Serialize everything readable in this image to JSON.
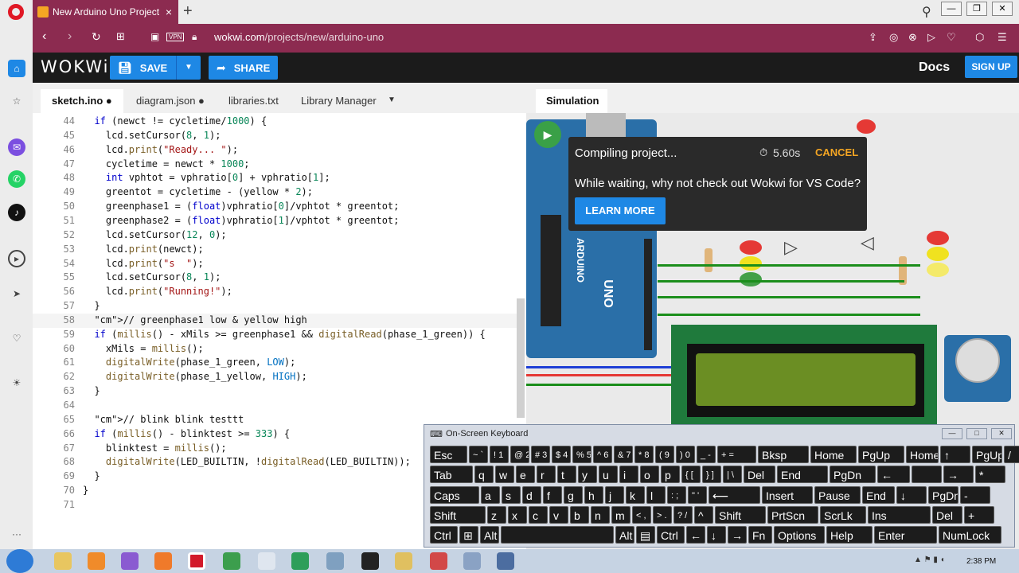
{
  "browser": {
    "tab_title": "New Arduino Uno Project",
    "tab_close": "×",
    "new_tab": "+",
    "url_domain": "wokwi.com",
    "url_path": "/projects/new/arduino-uno",
    "vpn_badge": "VPN"
  },
  "header": {
    "logo": "WOKWi",
    "save_label": "SAVE",
    "share_label": "SHARE",
    "docs_label": "Docs",
    "signup_label": "SIGN UP"
  },
  "editor_tabs": [
    {
      "label": "sketch.ino ●"
    },
    {
      "label": "diagram.json ●"
    },
    {
      "label": "libraries.txt"
    },
    {
      "label": "Library Manager"
    }
  ],
  "code_lines": [
    {
      "n": "44",
      "code": "  if (newct != cycletime/1000) {"
    },
    {
      "n": "45",
      "code": "    lcd.setCursor(8, 1);"
    },
    {
      "n": "46",
      "code": "    lcd.print(\"Ready... \");"
    },
    {
      "n": "47",
      "code": "    cycletime = newct * 1000;"
    },
    {
      "n": "48",
      "code": "    int vphtot = vphratio[0] + vphratio[1];"
    },
    {
      "n": "49",
      "code": "    greentot = cycletime - (yellow * 2);"
    },
    {
      "n": "50",
      "code": "    greenphase1 = (float)vphratio[0]/vphtot * greentot;"
    },
    {
      "n": "51",
      "code": "    greenphase2 = (float)vphratio[1]/vphtot * greentot;"
    },
    {
      "n": "52",
      "code": "    lcd.setCursor(12, 0);"
    },
    {
      "n": "53",
      "code": "    lcd.print(newct);"
    },
    {
      "n": "54",
      "code": "    lcd.print(\"s  \");"
    },
    {
      "n": "55",
      "code": "    lcd.setCursor(8, 1);"
    },
    {
      "n": "56",
      "code": "    lcd.print(\"Running!\");"
    },
    {
      "n": "57",
      "code": "  }"
    },
    {
      "n": "58",
      "code": "  // greenphase1 low & yellow high"
    },
    {
      "n": "59",
      "code": "  if (millis() - xMils >= greenphase1 && digitalRead(phase_1_green)) {"
    },
    {
      "n": "60",
      "code": "    xMils = millis();"
    },
    {
      "n": "61",
      "code": "    digitalWrite(phase_1_green, LOW);"
    },
    {
      "n": "62",
      "code": "    digitalWrite(phase_1_yellow, HIGH);"
    },
    {
      "n": "63",
      "code": "  }"
    },
    {
      "n": "64",
      "code": ""
    },
    {
      "n": "65",
      "code": "  // blink blink testtt"
    },
    {
      "n": "66",
      "code": "  if (millis() - blinktest >= 333) {"
    },
    {
      "n": "67",
      "code": "    blinktest = millis();"
    },
    {
      "n": "68",
      "code": "    digitalWrite(LED_BUILTIN, !digitalRead(LED_BUILTIN));"
    },
    {
      "n": "69",
      "code": "  }"
    },
    {
      "n": "70",
      "code": "}"
    },
    {
      "n": "71",
      "code": ""
    }
  ],
  "simulation": {
    "tab_label": "Simulation",
    "compiling_text": "Compiling project...",
    "timer": "5.60s",
    "cancel_label": "CANCEL",
    "promo_text": "While waiting, why not check out Wokwi for VS Code?",
    "learn_more_label": "LEARN MORE",
    "board_label": "UNO",
    "board_logo": "ARDUINO"
  },
  "keyboard": {
    "title": "On-Screen Keyboard",
    "rows": [
      [
        "Esc",
        "~ `",
        "! 1",
        "@ 2",
        "# 3",
        "$ 4",
        "% 5",
        "^ 6",
        "& 7",
        "* 8",
        "( 9",
        ") 0",
        "_ -",
        "+ =",
        "Bksp",
        "Home",
        "PgUp",
        "Home",
        "↑",
        "PgUp",
        "/"
      ],
      [
        "Tab",
        "q",
        "w",
        "e",
        "r",
        "t",
        "y",
        "u",
        "i",
        "o",
        "p",
        "{ [",
        "} ]",
        "| \\",
        "Del",
        "End",
        "PgDn",
        "←",
        "",
        "→",
        "*"
      ],
      [
        "Caps",
        "a",
        "s",
        "d",
        "f",
        "g",
        "h",
        "j",
        "k",
        "l",
        ": ;",
        "\" '",
        "⟵",
        "Insert",
        "Pause",
        "End",
        "↓",
        "PgDn",
        "-"
      ],
      [
        "Shift",
        "z",
        "x",
        "c",
        "v",
        "b",
        "n",
        "m",
        "< ,",
        "> .",
        "? /",
        "^",
        "Shift",
        "PrtScn",
        "ScrLk",
        "Ins",
        "Del",
        "+"
      ],
      [
        "Ctrl",
        "⊞",
        "Alt",
        "",
        "Alt",
        "▤",
        "Ctrl",
        "←",
        "↓",
        "→",
        "Fn",
        "Options",
        "Help",
        "Enter",
        "NumLock"
      ]
    ]
  },
  "taskbar": {
    "clock": "2:38 PM"
  },
  "colors": {
    "browser_accent": "#8c2b50",
    "wokwi_blue": "#1e88e5",
    "cancel_orange": "#f5a623"
  }
}
